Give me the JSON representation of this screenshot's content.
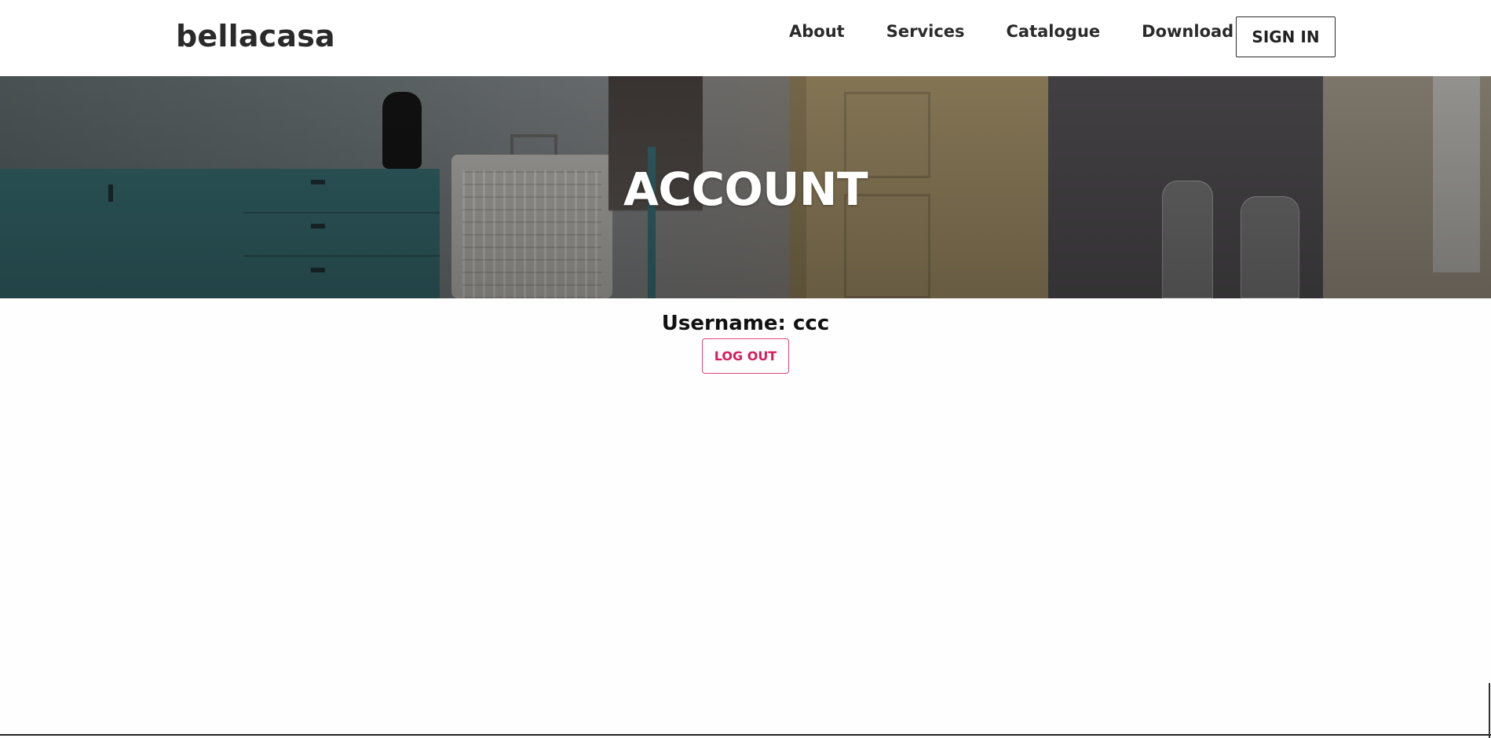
{
  "header": {
    "logo": "bellacasa",
    "nav": [
      "About",
      "Services",
      "Catalogue",
      "Download"
    ],
    "sign_in_label": "SIGN IN"
  },
  "hero": {
    "title": "ACCOUNT"
  },
  "account": {
    "username_text": "Username: ccc",
    "logout_label": "LOG OUT"
  },
  "colors": {
    "accent": "#d81c5c",
    "text": "#2a2a2a"
  }
}
